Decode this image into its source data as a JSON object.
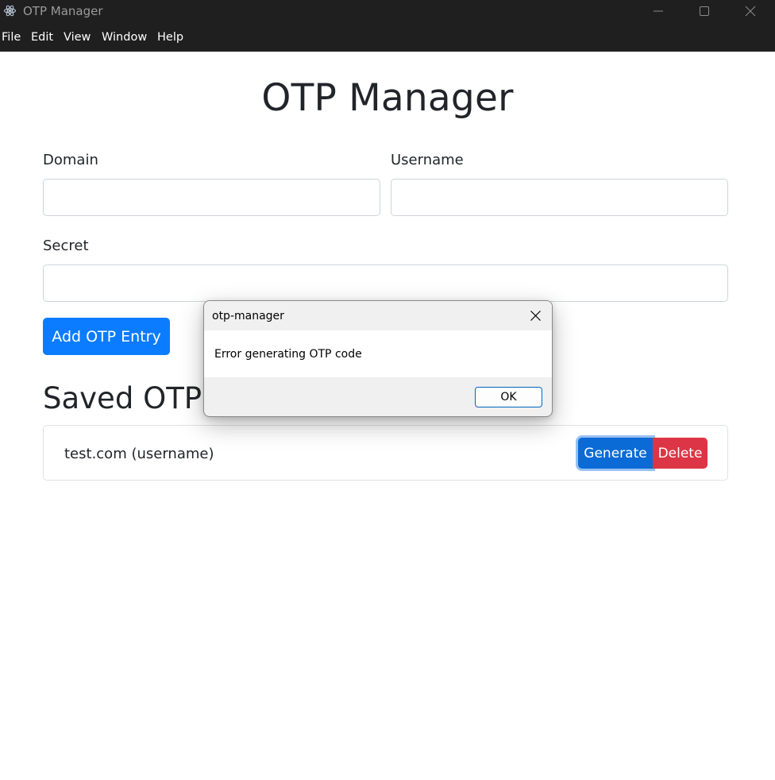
{
  "window": {
    "title": "OTP Manager",
    "controls": [
      "minimize",
      "maximize",
      "close"
    ]
  },
  "menu": {
    "items": [
      "File",
      "Edit",
      "View",
      "Window",
      "Help"
    ]
  },
  "main": {
    "title": "OTP Manager",
    "form": {
      "domain_label": "Domain",
      "domain_value": "",
      "username_label": "Username",
      "username_value": "",
      "secret_label": "Secret",
      "secret_value": "",
      "add_button": "Add OTP Entry"
    },
    "saved_title": "Saved OTP",
    "entries": [
      {
        "label": "test.com (username)",
        "generate": "Generate",
        "delete": "Delete"
      }
    ]
  },
  "dialog": {
    "title": "otp-manager",
    "message": "Error generating OTP code",
    "ok": "OK"
  },
  "colors": {
    "titlebar": "#1f1f1f",
    "primary": "#0b7cff",
    "generate": "#0b6bd6",
    "danger": "#dc3545"
  }
}
